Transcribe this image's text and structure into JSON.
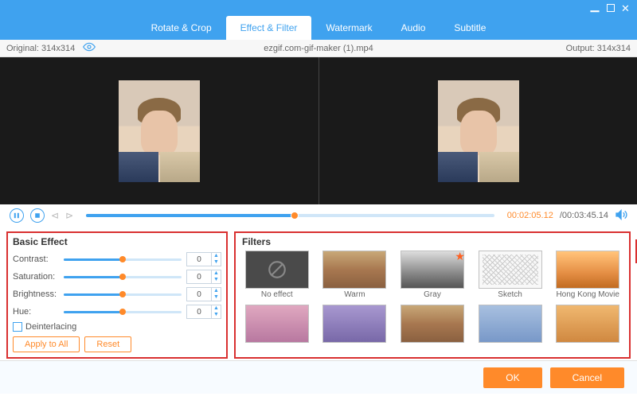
{
  "window": {},
  "tabs": [
    {
      "label": "Rotate & Crop",
      "active": false
    },
    {
      "label": "Effect & Filter",
      "active": true
    },
    {
      "label": "Watermark",
      "active": false
    },
    {
      "label": "Audio",
      "active": false
    },
    {
      "label": "Subtitle",
      "active": false
    }
  ],
  "infobar": {
    "original_label": "Original: 314x314",
    "filename": "ezgif.com-gif-maker (1).mp4",
    "output_label": "Output: 314x314"
  },
  "player": {
    "current_time": "00:02:05.12",
    "total_time": "/00:03:45.14",
    "progress_pct": 51
  },
  "basic_effect": {
    "title": "Basic Effect",
    "sliders": [
      {
        "label": "Contrast:",
        "value": "0",
        "pct": 50
      },
      {
        "label": "Saturation:",
        "value": "0",
        "pct": 50
      },
      {
        "label": "Brightness:",
        "value": "0",
        "pct": 50
      },
      {
        "label": "Hue:",
        "value": "0",
        "pct": 50
      }
    ],
    "deinterlacing_label": "Deinterlacing",
    "apply_all_label": "Apply to All",
    "reset_label": "Reset"
  },
  "filters": {
    "title": "Filters",
    "items": [
      {
        "label": "No effect",
        "kind": "no",
        "star": false
      },
      {
        "label": "Warm",
        "kind": "img",
        "star": false
      },
      {
        "label": "Gray",
        "kind": "gray",
        "star": true
      },
      {
        "label": "Sketch",
        "kind": "sketch",
        "star": false
      },
      {
        "label": "Hong Kong Movie",
        "kind": "hk",
        "star": false
      },
      {
        "label": "",
        "kind": "pink",
        "star": false
      },
      {
        "label": "",
        "kind": "purple",
        "star": false
      },
      {
        "label": "",
        "kind": "img",
        "star": false
      },
      {
        "label": "",
        "kind": "blue",
        "star": false
      },
      {
        "label": "",
        "kind": "orange",
        "star": false
      }
    ]
  },
  "footer": {
    "ok_label": "OK",
    "cancel_label": "Cancel"
  }
}
